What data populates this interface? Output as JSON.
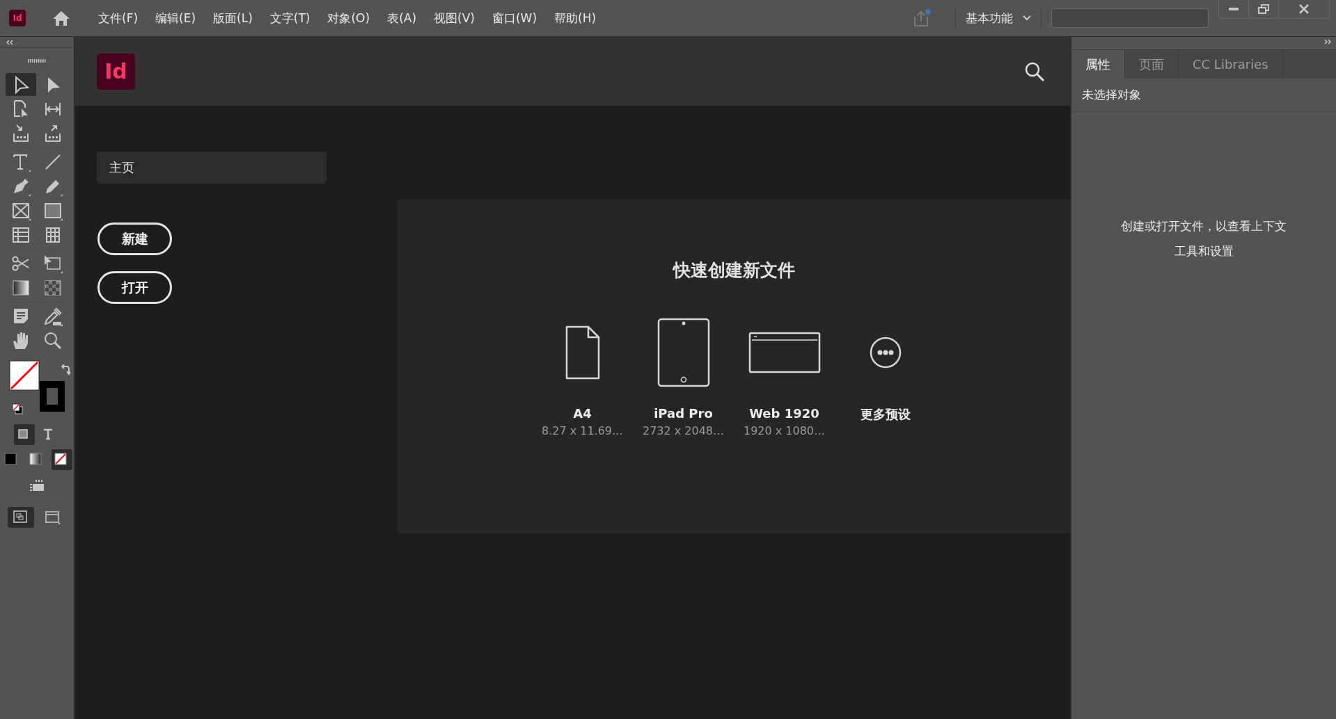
{
  "app_icon": {
    "label": "Id"
  },
  "menu": [
    {
      "label": "文件(F)"
    },
    {
      "label": "编辑(E)"
    },
    {
      "label": "版面(L)"
    },
    {
      "label": "文字(T)"
    },
    {
      "label": "对象(O)"
    },
    {
      "label": "表(A)"
    },
    {
      "label": "视图(V)"
    },
    {
      "label": "窗口(W)"
    },
    {
      "label": "帮助(H)"
    }
  ],
  "workspace": {
    "label": "基本功能"
  },
  "tools": [
    {
      "kind": "selection",
      "selected": true
    },
    {
      "kind": "direct-selection",
      "selected": false
    },
    {
      "kind": "page",
      "selected": false
    },
    {
      "kind": "gap",
      "selected": false
    },
    {
      "kind": "collector",
      "selected": false
    },
    {
      "kind": "placer",
      "selected": false
    },
    {
      "kind": "type",
      "selected": false
    },
    {
      "kind": "line",
      "selected": false
    },
    {
      "kind": "pen",
      "selected": false
    },
    {
      "kind": "pencil",
      "selected": false
    },
    {
      "kind": "frame",
      "selected": false
    },
    {
      "kind": "rectangle",
      "selected": false
    },
    {
      "kind": "table-rows",
      "selected": false
    },
    {
      "kind": "table-columns",
      "selected": false
    },
    {
      "kind": "scissors",
      "selected": false
    },
    {
      "kind": "transform",
      "selected": false
    },
    {
      "kind": "gradient",
      "selected": false
    },
    {
      "kind": "feather",
      "selected": false
    },
    {
      "kind": "note",
      "selected": false
    },
    {
      "kind": "eyedropper",
      "selected": false
    },
    {
      "kind": "hand",
      "selected": false
    },
    {
      "kind": "zoom",
      "selected": false
    }
  ],
  "format_modes": [
    {
      "kind": "container",
      "selected": true
    },
    {
      "kind": "text",
      "selected": false
    }
  ],
  "apply_modes": [
    {
      "kind": "color",
      "selected": false
    },
    {
      "kind": "gradient",
      "selected": false
    },
    {
      "kind": "none",
      "selected": true
    }
  ],
  "view_modes": [
    {
      "kind": "normal",
      "selected": true
    },
    {
      "kind": "screen",
      "selected": false
    }
  ],
  "home": {
    "logo": "Id",
    "nav": [
      {
        "label": "主页",
        "selected": true
      }
    ],
    "buttons": [
      {
        "label": "新建"
      },
      {
        "label": "打开"
      }
    ],
    "quick_create": {
      "title": "快速创建新文件",
      "presets": [
        {
          "kind": "page",
          "name": "A4",
          "size": "8.27 x 11.69…"
        },
        {
          "kind": "tablet",
          "name": "iPad Pro",
          "size": "2732 x 2048…"
        },
        {
          "kind": "web",
          "name": "Web 1920",
          "size": "1920 x 1080…"
        },
        {
          "kind": "more",
          "name": "更多预设"
        }
      ]
    }
  },
  "panel": {
    "tabs": [
      {
        "label": "属性",
        "selected": true
      },
      {
        "label": "页面",
        "selected": false
      },
      {
        "label": "CC Libraries",
        "selected": false
      }
    ],
    "heading": "未选择对象",
    "message": [
      "创建或打开文件，以查看上下文",
      "工具和设置"
    ]
  }
}
